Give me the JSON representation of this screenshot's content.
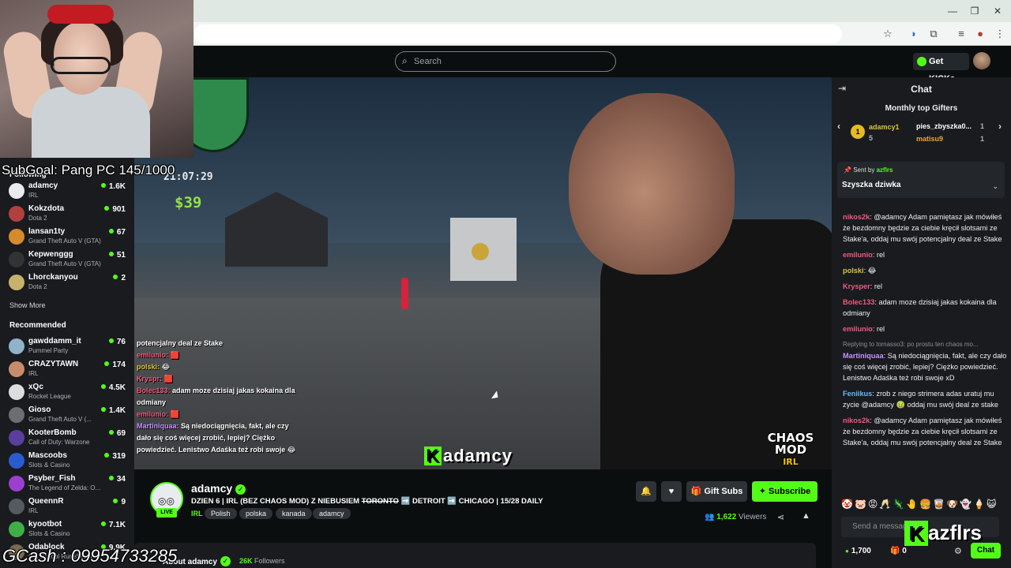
{
  "search": {
    "placeholder": "Search"
  },
  "topnav": {
    "get_kicks": "Get KICKs"
  },
  "overlay": {
    "subgoal": "SubGoal: Pang PC 145/1000",
    "gcash": "GCash : 09954733285"
  },
  "sidebar": {
    "following_label": "Following",
    "following": [
      {
        "name": "adamcy",
        "category": "IRL",
        "viewers": "1.6K"
      },
      {
        "name": "Kokzdota",
        "category": "Dota 2",
        "viewers": "901"
      },
      {
        "name": "lansan1ty",
        "category": "Grand Theft Auto V (GTA)",
        "viewers": "67"
      },
      {
        "name": "Kepwenggg",
        "category": "Grand Theft Auto V (GTA)",
        "viewers": "51"
      },
      {
        "name": "Lhorckanyou",
        "category": "Dota 2",
        "viewers": "2"
      }
    ],
    "show_more": "Show More",
    "recommended_label": "Recommended",
    "recommended": [
      {
        "name": "gawddamm_it",
        "category": "Pummel Party",
        "viewers": "76"
      },
      {
        "name": "CRAZYTAWN",
        "category": "IRL",
        "viewers": "174"
      },
      {
        "name": "xQc",
        "category": "Rocket League",
        "viewers": "4.5K"
      },
      {
        "name": "Gioso",
        "category": "Grand Theft Auto V (...",
        "viewers": "1.4K"
      },
      {
        "name": "KooterBomb",
        "category": "Call of Duty: Warzone",
        "viewers": "69"
      },
      {
        "name": "Mascoobs",
        "category": "Slots & Casino",
        "viewers": "319"
      },
      {
        "name": "Psyber_Fish",
        "category": "The Legend of Zelda: O...",
        "viewers": "34"
      },
      {
        "name": "QueennR",
        "category": "IRL",
        "viewers": "9"
      },
      {
        "name": "kyootbot",
        "category": "Slots & Casino",
        "viewers": "7.1K"
      },
      {
        "name": "Odablock",
        "category": "Old School RuneScape",
        "viewers": "9.9K"
      }
    ]
  },
  "video": {
    "clock": "21:07:29",
    "money": "$39",
    "brand": "adamcy",
    "brand_k": "K",
    "chaos_title": "CHAOS MOD",
    "chaos_sub": "IRL",
    "chat_lines": [
      {
        "user": "",
        "text": "potencjalny deal ze Stake"
      },
      {
        "user": "emilunio:",
        "text": "🟥"
      },
      {
        "user": "polski:",
        "text": "😂"
      },
      {
        "user": "Kryspr:",
        "text": "🟥"
      },
      {
        "user": "Bolec133:",
        "text": "adam moze dzisiaj jakas kokaina dla odmiany"
      },
      {
        "user": "emilunio:",
        "text": "🟥"
      },
      {
        "user": "Martiniquaa:",
        "text": "Są niedociągnięcia, fakt, ale czy dało się coś więcej zrobić, lepiej? Ciężko powiedzieć. Lenistwo Adaśka też robi swoje 😂"
      }
    ]
  },
  "stream": {
    "channel": "adamcy",
    "live": "LIVE",
    "title_pre": "DZIEN 6 | IRL (BEZ CHAOS MOD) Z NIEBUSIEM ",
    "title_strike": "TORONTO",
    "title_post": " ➡️ DETROIT ➡️ CHICAGO | 15/28 DAILY",
    "category": "IRL",
    "tags": [
      "Polish",
      "polska",
      "kanada",
      "adamcy"
    ],
    "gift_subs": "Gift Subs",
    "subscribe": "Subscribe",
    "viewers_count": "1,622",
    "viewers_label": "Viewers",
    "about": "About adamcy",
    "followers_count": "26K",
    "followers_label": "Followers"
  },
  "chat": {
    "title": "Chat",
    "gifters_title": "Monthly top Gifters",
    "gifters": [
      {
        "rank": "1",
        "name": "adamcy1",
        "count": "5"
      },
      {
        "name": "pies_zbyszka0...",
        "count": "1"
      },
      {
        "name": "matisu9",
        "count": "1"
      }
    ],
    "pinned_by_label": "Sent by",
    "pinned_by": "azflrs",
    "pinned_text": "Szyszka dziwka",
    "messages": [
      {
        "user": "nikos2k",
        "cls": "u1",
        "text": ": @adamcy Adam pamiętasz jak mówiłeś że bezdomny będzie za ciebie kręcił slotsami ze Stake'a, oddaj mu swój potencjalny deal ze Stake"
      },
      {
        "user": "emilunio",
        "cls": "u1",
        "text": ": rel"
      },
      {
        "user": "polski",
        "cls": "u2",
        "text": ": 😂"
      },
      {
        "user": "Krysper",
        "cls": "u1",
        "text": ": rel"
      },
      {
        "user": "Bolec133",
        "cls": "u1",
        "text": ": adam moze dzisiaj jakas kokaina dla odmiany"
      },
      {
        "user": "emilunio",
        "cls": "u1",
        "text": ": rel"
      },
      {
        "reply": "Replying to tomasso3: po prostu ten chaos mo...",
        "user": "Martiniquaa",
        "cls": "u3",
        "text": ": Są niedociągnięcia, fakt, ale czy dało się coś więcej zrobić, lepiej? Ciężko powiedzieć. Lenistwo Adaśka też robi swoje xD"
      },
      {
        "user": "Feniikus",
        "cls": "u4",
        "text": ": zrob z niego strimera adas uratuj mu zycie @adamcy 🤢 oddaj mu swój deal ze stake"
      },
      {
        "user": "nikos2k",
        "cls": "u1",
        "text": ": @adamcy Adam pamiętasz jak mówiłeś że bezdomny będzie za ciebie kręcił slotsami ze Stake'a, oddaj mu swój potencjalny deal ze Stake"
      }
    ],
    "emotes": "🤡🐷😡🥂🦎🤚🍔🥃🐶👻🍦😺",
    "input_placeholder": "Send a message",
    "kazfirs_k": "K",
    "kazfirs": "azflrs",
    "kicks": "1,700",
    "gifts": "0",
    "send": "Chat"
  }
}
